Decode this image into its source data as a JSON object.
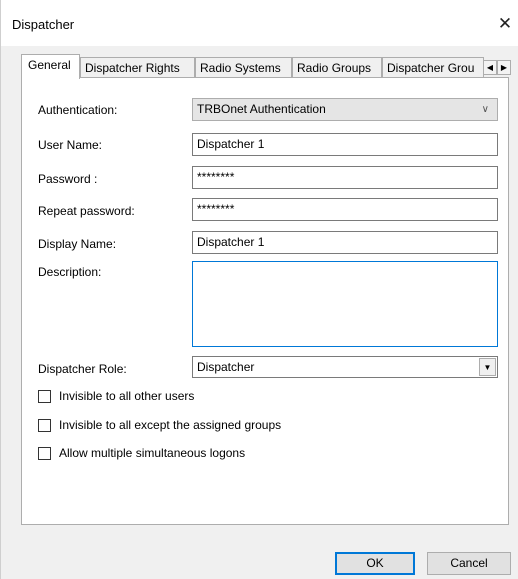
{
  "window": {
    "title": "Dispatcher",
    "close_glyph": "✕"
  },
  "tabs": [
    {
      "label": "General",
      "active": true
    },
    {
      "label": "Dispatcher Rights"
    },
    {
      "label": "Radio Systems"
    },
    {
      "label": "Radio Groups"
    },
    {
      "label": "Dispatcher Grou"
    }
  ],
  "tab_scroll": {
    "left_glyph": "◀",
    "right_glyph": "▶"
  },
  "form": {
    "authentication": {
      "label": "Authentication:",
      "value": "TRBOnet Authentication",
      "chevron": "∨"
    },
    "user_name": {
      "label": "User Name:",
      "value": "Dispatcher 1"
    },
    "password": {
      "label": "Password :",
      "value": "********"
    },
    "repeat_password": {
      "label": "Repeat password:",
      "value": "********"
    },
    "display_name": {
      "label": "Display Name:",
      "value": "Dispatcher 1"
    },
    "description": {
      "label": "Description:",
      "value": ""
    },
    "dispatcher_role": {
      "label": "Dispatcher Role:",
      "value": "Dispatcher",
      "dropdown_glyph": "▼"
    }
  },
  "options": [
    {
      "label": "Invisible to all other users",
      "checked": false
    },
    {
      "label": "Invisible to all except the assigned groups",
      "checked": false
    },
    {
      "label": "Allow multiple simultaneous logons",
      "checked": false
    }
  ],
  "buttons": {
    "ok": "OK",
    "cancel": "Cancel"
  },
  "colors": {
    "accent": "#0078d7",
    "client_bg": "#f0f0f0",
    "page_bg": "#ffffff"
  }
}
